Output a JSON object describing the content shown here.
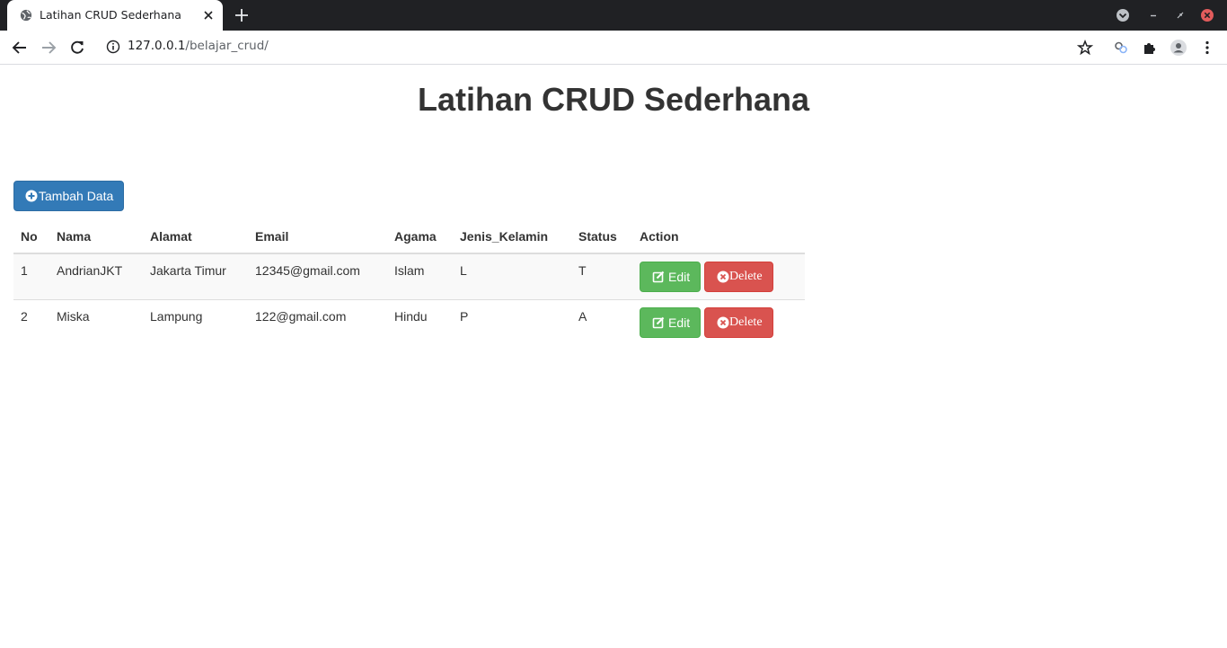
{
  "browser": {
    "tab_title": "Latihan CRUD Sederhana",
    "url_host": "127.0.0.1",
    "url_path": "/belajar_crud/"
  },
  "page": {
    "title": "Latihan CRUD Sederhana",
    "add_button_label": "Tambah Data"
  },
  "table": {
    "headers": [
      "No",
      "Nama",
      "Alamat",
      "Email",
      "Agama",
      "Jenis_Kelamin",
      "Status",
      "Action"
    ],
    "rows": [
      {
        "no": "1",
        "nama": "AndrianJKT",
        "alamat": "Jakarta Timur",
        "email": "12345@gmail.com",
        "agama": "Islam",
        "jk": "L",
        "status": "T"
      },
      {
        "no": "2",
        "nama": "Miska",
        "alamat": "Lampung",
        "email": "122@gmail.com",
        "agama": "Hindu",
        "jk": "P",
        "status": "A"
      }
    ],
    "edit_label": "Edit",
    "delete_label": "Delete"
  },
  "colors": {
    "primary": "#337ab7",
    "success": "#5cb85c",
    "danger": "#d9534f",
    "chrome_dark": "#202124"
  },
  "icons": {
    "favicon": "globe-icon",
    "tab_close": "close-icon",
    "new_tab": "plus-icon",
    "back": "arrow-left-icon",
    "forward": "arrow-right-icon",
    "reload": "reload-icon",
    "site_info": "info-icon",
    "bookmark": "star-icon",
    "extension": "puzzle-icon",
    "profile": "avatar-icon",
    "menu": "kebab-icon",
    "add": "plus-circle-icon",
    "edit": "edit-icon",
    "delete": "times-circle-icon"
  }
}
